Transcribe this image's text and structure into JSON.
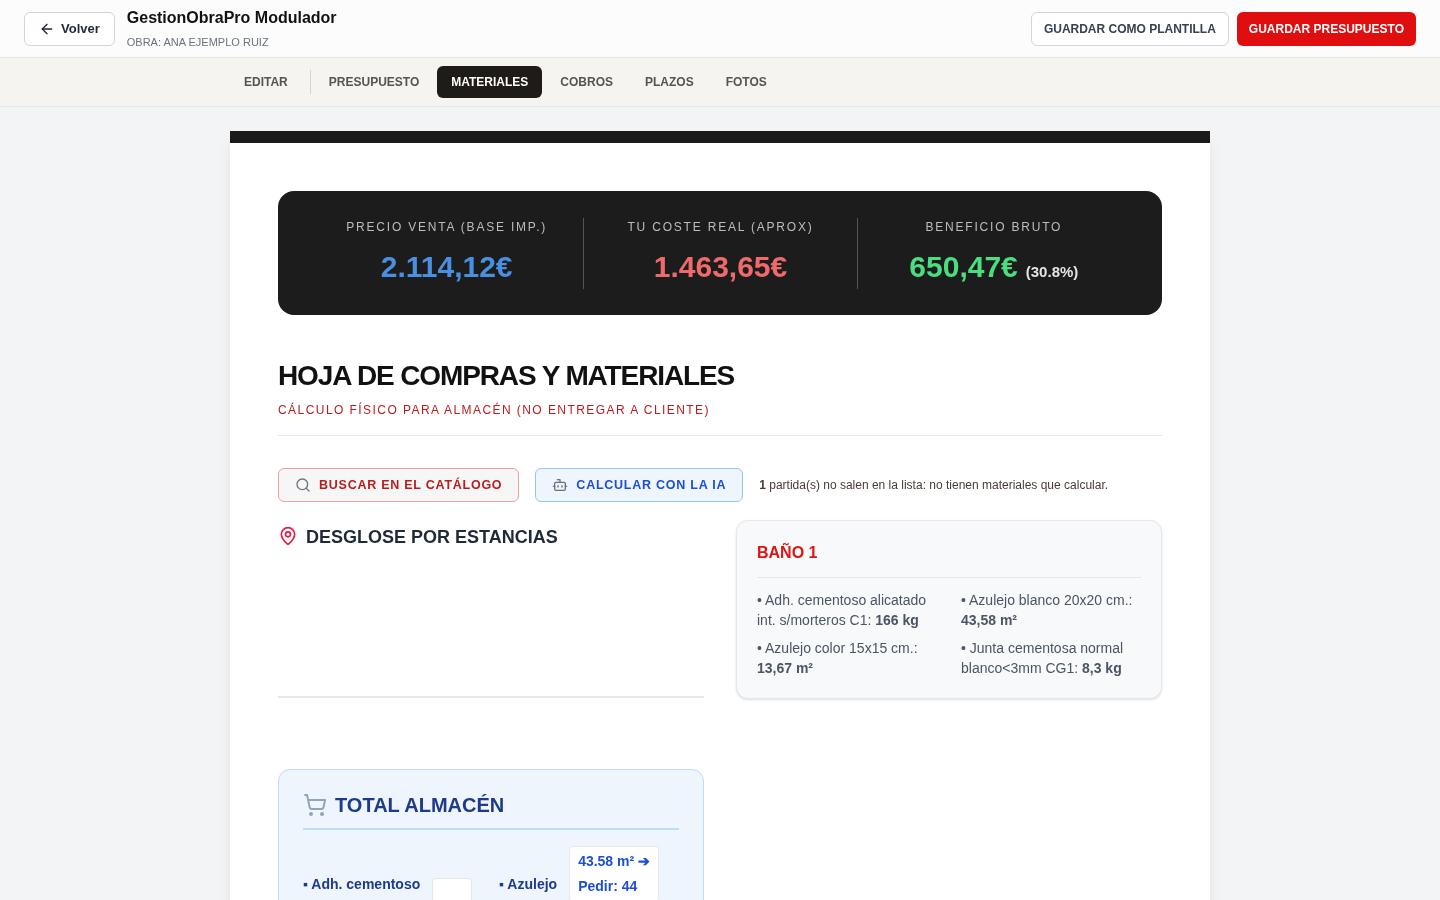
{
  "header": {
    "back_label": "Volver",
    "title": "GestionObraPro Modulador",
    "subtitle": "OBRA: ANA EJEMPLO RUIZ",
    "buttons": [
      {
        "label": "GUARDAR COMO PLANTILLA",
        "kind": "outline"
      },
      {
        "label": "GUARDAR PRESUPUESTO",
        "kind": "primary"
      }
    ]
  },
  "tabs": [
    {
      "label": "EDITAR",
      "selected": false
    },
    {
      "label": "PRESUPUESTO",
      "selected": false
    },
    {
      "label": "MATERIALES",
      "selected": true
    },
    {
      "label": "COBROS",
      "selected": false
    },
    {
      "label": "PLAZOS",
      "selected": false
    },
    {
      "label": "FOTOS",
      "selected": false
    }
  ],
  "summary": [
    {
      "label": "PRECIO VENTA (BASE IMP.)",
      "value": "2.114,12€",
      "color": "#4a90e2"
    },
    {
      "label": "TU COSTE REAL (APROX)",
      "value": "1.463,65€",
      "color": "#ef6b6b"
    },
    {
      "label": "BENEFICIO BRUTO",
      "value": "650,47€",
      "extra": "(30.8%)",
      "color": "#4ade80"
    }
  ],
  "sheet": {
    "title": "HOJA DE COMPRAS Y MATERIALES",
    "subtitle": "CÁLCULO FÍSICO PARA ALMACÉN (NO ENTREGAR A CLIENTE)",
    "actions": [
      {
        "label": "BUSCAR EN EL CATÁLOGO",
        "kind": "catalog"
      },
      {
        "label": "CALCULAR CON LA IA",
        "kind": "ai"
      }
    ],
    "notice": "**1** partida(s) no salen en la lista: no tienen materiales que calcular.",
    "breakdown_title": "DESGLOSE POR ESTANCIAS",
    "rooms": [
      {
        "name": "BAÑO 1",
        "items": [
          "• Adh. cementoso alicatado int. s/morteros C1: **166 kg**",
          "• Azulejo blanco 20x20 cm.: **43,58 m²**",
          "• Azulejo color 15x15 cm.: **13,67 m²**",
          "• Junta cementosa normal blanco<3mm CG1: **8,3 kg**"
        ]
      }
    ],
    "total": {
      "title": "TOTAL ALMACÉN",
      "items": [
        {
          "name": "▪ Adh. cementoso"
        },
        {
          "name": "▪ Azulejo",
          "lines": [
            "43.58 m² ➔",
            "Pedir: **44**"
          ]
        }
      ]
    }
  }
}
